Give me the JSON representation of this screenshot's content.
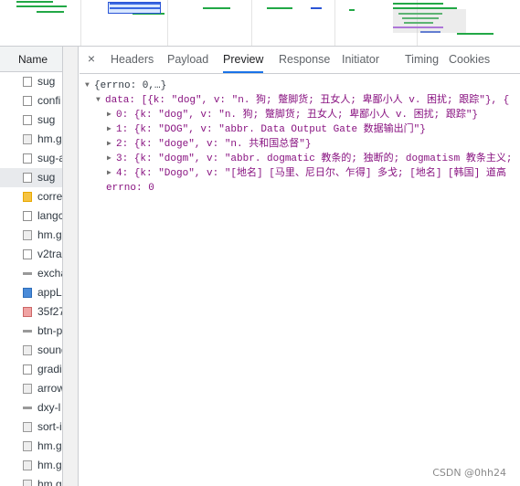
{
  "overview": {},
  "sidebar": {
    "header": "Name",
    "items": [
      {
        "label": "sug",
        "icon": "doc"
      },
      {
        "label": "confi",
        "icon": "doc"
      },
      {
        "label": "sug",
        "icon": "doc"
      },
      {
        "label": "hm.g",
        "icon": "gif"
      },
      {
        "label": "sug-a",
        "icon": "doc"
      },
      {
        "label": "sug",
        "icon": "doc"
      },
      {
        "label": "corre",
        "icon": "js"
      },
      {
        "label": "langc",
        "icon": "doc"
      },
      {
        "label": "hm.g",
        "icon": "gif"
      },
      {
        "label": "v2tra",
        "icon": "doc"
      },
      {
        "label": "excha",
        "icon": "line"
      },
      {
        "label": "appL",
        "icon": "img"
      },
      {
        "label": "35f27",
        "icon": "img2"
      },
      {
        "label": "btn-p",
        "icon": "line"
      },
      {
        "label": "sound",
        "icon": "gif"
      },
      {
        "label": "gradi",
        "icon": "doc"
      },
      {
        "label": "arrow",
        "icon": "gif"
      },
      {
        "label": "dxy-l",
        "icon": "line"
      },
      {
        "label": "sort-i",
        "icon": "gif"
      },
      {
        "label": "hm.g",
        "icon": "gif"
      },
      {
        "label": "hm.g",
        "icon": "gif"
      },
      {
        "label": "hm.g",
        "icon": "gif"
      }
    ]
  },
  "tabs": {
    "close": "×",
    "items": [
      "Headers",
      "Payload",
      "Preview",
      "Response",
      "Initiator",
      "Timing",
      "Cookies"
    ],
    "active": "Preview"
  },
  "preview": {
    "root": "{errno: 0,…}",
    "data_line": "data: [{k: \"dog\", v: \"n. 狗; 蹩脚货; 丑女人; 卑鄙小人 v. 困扰; 跟踪\"}, {",
    "rows": [
      "0: {k: \"dog\", v: \"n. 狗; 蹩脚货; 丑女人; 卑鄙小人 v. 困扰; 跟踪\"}",
      "1: {k: \"DOG\", v: \"abbr. Data Output Gate 数据输出门\"}",
      "2: {k: \"doge\", v: \"n. 共和国总督\"}",
      "3: {k: \"dogm\", v: \"abbr. dogmatic 教条的; 独断的; dogmatism 教条主义;",
      "4: {k: \"Dogo\", v: \"[地名] [马里、尼日尔、乍得] 多戈; [地名] [韩国] 道高"
    ],
    "errno": "errno: 0"
  },
  "watermark": "CSDN @0hh24"
}
